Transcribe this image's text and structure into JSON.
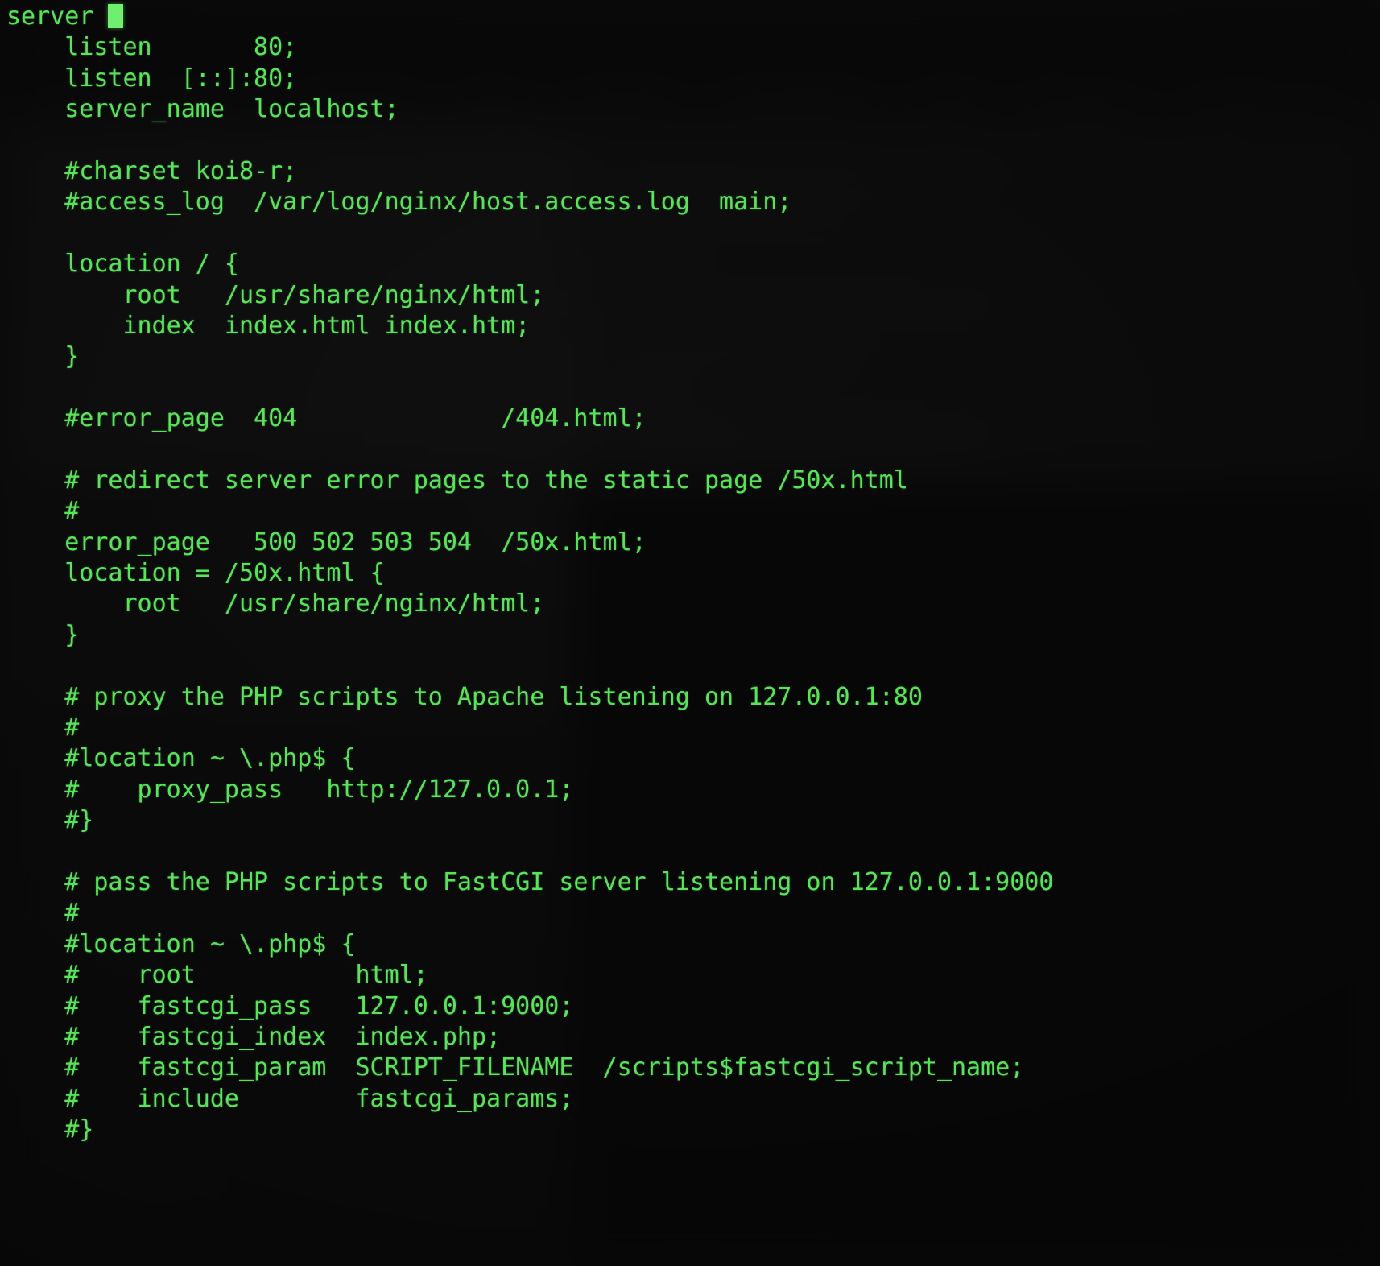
{
  "terminal": {
    "kind": "terminal-editor",
    "colors": {
      "foreground": "#5ae25a",
      "background": "#121212",
      "cursor": "#6ef06e"
    },
    "cursor": {
      "style": "block",
      "line": 1,
      "column": 8,
      "glyph": "block-cursor"
    },
    "font_size_px": 30,
    "line_height_px": 38,
    "file_kind": "nginx-configuration",
    "lines": [
      "server ",
      "    listen       80;",
      "    listen  [::]:80;",
      "    server_name  localhost;",
      "",
      "    #charset koi8-r;",
      "    #access_log  /var/log/nginx/host.access.log  main;",
      "",
      "    location / {",
      "        root   /usr/share/nginx/html;",
      "        index  index.html index.htm;",
      "    }",
      "",
      "    #error_page  404              /404.html;",
      "",
      "    # redirect server error pages to the static page /50x.html",
      "    #",
      "    error_page   500 502 503 504  /50x.html;",
      "    location = /50x.html {",
      "        root   /usr/share/nginx/html;",
      "    }",
      "",
      "    # proxy the PHP scripts to Apache listening on 127.0.0.1:80",
      "    #",
      "    #location ~ \\.php$ {",
      "    #    proxy_pass   http://127.0.0.1;",
      "    #}",
      "",
      "    # pass the PHP scripts to FastCGI server listening on 127.0.0.1:9000",
      "    #",
      "    #location ~ \\.php$ {",
      "    #    root           html;",
      "    #    fastcgi_pass   127.0.0.1:9000;",
      "    #    fastcgi_index  index.php;",
      "    #    fastcgi_param  SCRIPT_FILENAME  /scripts$fastcgi_script_name;",
      "    #    include        fastcgi_params;",
      "    #}"
    ]
  },
  "backdrop": {
    "description": "blurred-dark-desktop-behind-translucent-terminal",
    "bookmark_chips": 9,
    "table_rows": 7,
    "list_stripes": 10
  }
}
